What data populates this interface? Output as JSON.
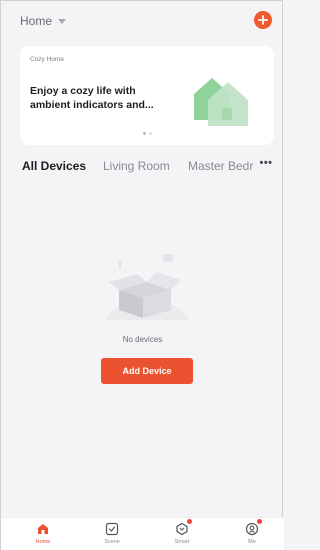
{
  "header": {
    "home_label": "Home"
  },
  "banner": {
    "tag": "Cozy Home",
    "headline": "Enjoy a cozy life with ambient indicators and..."
  },
  "tabs": [
    {
      "label": "All Devices",
      "active": true
    },
    {
      "label": "Living Room",
      "active": false
    },
    {
      "label": "Master Bedro",
      "active": false
    }
  ],
  "tabs_more": "•••",
  "empty": {
    "message": "No devices",
    "button_label": "Add Device"
  },
  "tabbar": {
    "items": [
      {
        "label": "Home",
        "icon": "home-icon",
        "active": true
      },
      {
        "label": "Scene",
        "icon": "scene-icon",
        "active": false
      },
      {
        "label": "Smart",
        "icon": "smart-icon",
        "active": false,
        "badge": true
      },
      {
        "label": "Me",
        "icon": "me-icon",
        "active": false,
        "badge": true
      }
    ]
  },
  "colors": {
    "accent": "#ea5230",
    "background": "#f4f4f6",
    "badge": "#f2423a"
  }
}
